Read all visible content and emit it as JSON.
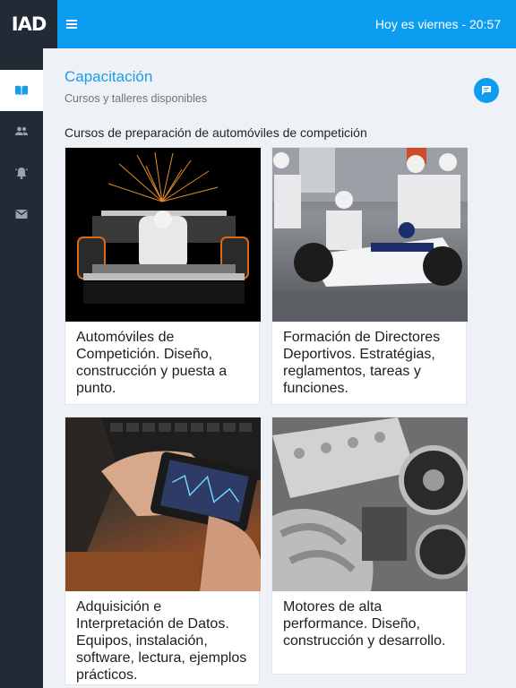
{
  "app": {
    "logo": "IAD"
  },
  "topbar": {
    "status": "Hoy es viernes - 20:57"
  },
  "sidebar": {
    "items": [
      {
        "icon": "book-icon",
        "active": true
      },
      {
        "icon": "users-icon",
        "active": false
      },
      {
        "icon": "bell-icon",
        "active": false
      },
      {
        "icon": "mail-icon",
        "active": false
      }
    ]
  },
  "page": {
    "title": "Capacitación",
    "subtitle": "Cursos y talleres disponibles",
    "section_title": "Cursos de preparación de automóviles de competición"
  },
  "courses": [
    {
      "title": "Automóviles de Competición. Diseño, construcción y puesta a punto.",
      "image": "race-car-image"
    },
    {
      "title": "Formación de Directores Deportivos. Estratégias, reglamentos, tareas y funciones.",
      "image": "pit-stop-image"
    },
    {
      "title": "Adquisición e Interpretación de Datos. Equipos, instalación, software, lectura, ejemplos prácticos.",
      "image": "data-acquisition-image"
    },
    {
      "title": "Motores de alta performance. Diseño, construcción y desarrollo.",
      "image": "engine-image"
    }
  ],
  "colors": {
    "accent": "#0d9df0",
    "sidebar": "#222a35",
    "title": "#1b9cea"
  }
}
